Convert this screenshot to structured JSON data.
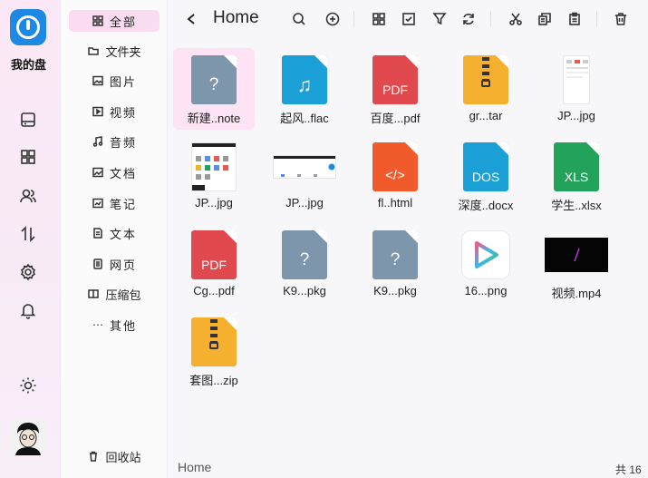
{
  "rail": {
    "app_title": "我的盘",
    "icons": [
      "drive-icon",
      "apps-icon",
      "users-icon",
      "transfer-icon",
      "settings-icon",
      "bell-icon",
      "theme-sun-icon"
    ]
  },
  "sidebar": {
    "items": [
      {
        "label": "全部",
        "icon": "grid-icon",
        "active": true
      },
      {
        "label": "文件夹",
        "icon": "folder-icon"
      },
      {
        "label": "图片",
        "icon": "image-icon"
      },
      {
        "label": "视频",
        "icon": "video-icon"
      },
      {
        "label": "音频",
        "icon": "music-icon"
      },
      {
        "label": "文档",
        "icon": "document-icon"
      },
      {
        "label": "笔记",
        "icon": "note-icon"
      },
      {
        "label": "文本",
        "icon": "text-icon"
      },
      {
        "label": "网页",
        "icon": "web-icon"
      },
      {
        "label": "压缩包",
        "icon": "archive-icon"
      },
      {
        "label": "其他",
        "icon": "more-icon"
      }
    ],
    "trash": "回收站"
  },
  "toolbar": {
    "title": "Home",
    "icons": [
      "search-icon",
      "add-icon",
      "view-grid-icon",
      "select-icon",
      "filter-icon",
      "refresh-icon",
      "cut-icon",
      "copy-icon",
      "paste-icon",
      "delete-icon"
    ]
  },
  "files": [
    {
      "name": "新建..note",
      "kind": "unknown",
      "color": "#7d96ab",
      "glyph": "?",
      "selected": true
    },
    {
      "name": "起风..flac",
      "kind": "audio",
      "color": "#1a9fd6",
      "glyph": "♫"
    },
    {
      "name": "百度...pdf",
      "kind": "pdf",
      "color": "#e04a4f",
      "glyph": "PDF"
    },
    {
      "name": "gr...tar",
      "kind": "zip",
      "color": "#f4b02e",
      "glyph": ""
    },
    {
      "name": "JP...jpg",
      "kind": "screenshot-tall",
      "color": "#ffffff",
      "glyph": ""
    },
    {
      "name": "JP...jpg",
      "kind": "screenshot-app",
      "color": "#ffffff",
      "glyph": ""
    },
    {
      "name": "JP...jpg",
      "kind": "screenshot-wide",
      "color": "#ffffff",
      "glyph": ""
    },
    {
      "name": "fl..html",
      "kind": "html",
      "color": "#f15a2a",
      "glyph": "</>"
    },
    {
      "name": "深度..docx",
      "kind": "doc",
      "color": "#1a9fd6",
      "glyph": "DOS"
    },
    {
      "name": "学生..xlsx",
      "kind": "xls",
      "color": "#22a25a",
      "glyph": "XLS"
    },
    {
      "name": "Cg...pdf",
      "kind": "pdf",
      "color": "#e04a4f",
      "glyph": "PDF"
    },
    {
      "name": "K9...pkg",
      "kind": "unknown",
      "color": "#7d96ab",
      "glyph": "?"
    },
    {
      "name": "K9...pkg",
      "kind": "unknown",
      "color": "#7d96ab",
      "glyph": "?"
    },
    {
      "name": "16...png",
      "kind": "play-logo",
      "color": "#ffffff",
      "glyph": ""
    },
    {
      "name": "视频.mp4",
      "kind": "video-dark",
      "color": "#050505",
      "glyph": ""
    },
    {
      "name": "套图...zip",
      "kind": "zip",
      "color": "#f4b02e",
      "glyph": ""
    }
  ],
  "footer": {
    "path": "Home",
    "count": "共 16"
  }
}
